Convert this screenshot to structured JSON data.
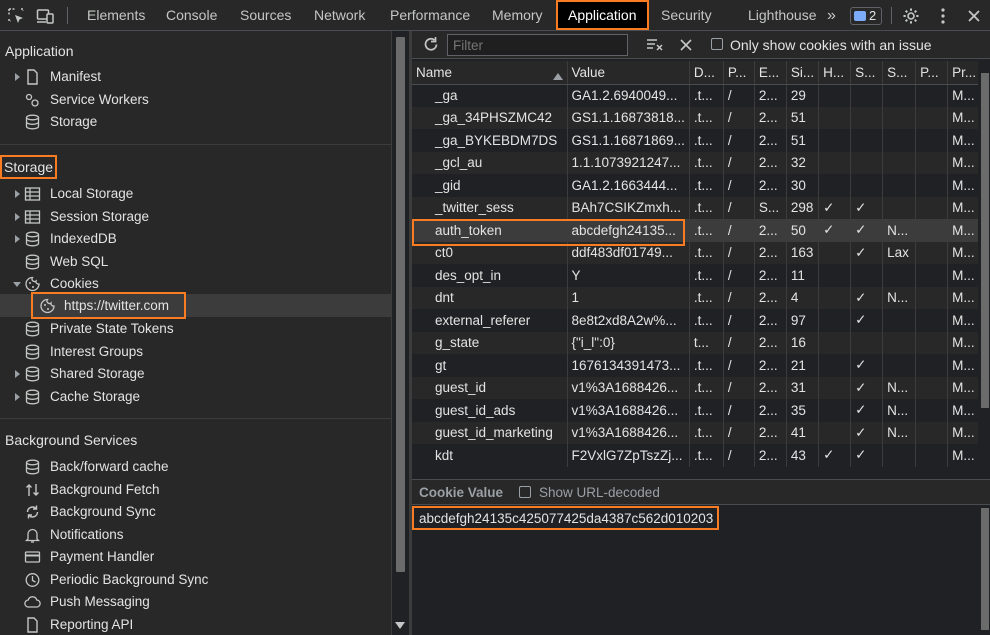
{
  "tabs": {
    "elements": "Elements",
    "console": "Console",
    "sources": "Sources",
    "network": "Network",
    "performance": "Performance",
    "memory": "Memory",
    "application": "Application",
    "security": "Security",
    "lighthouse": "Lighthouse",
    "more": "»",
    "issues_count": "2"
  },
  "sidebar": {
    "application_title": "Application",
    "application_items": {
      "manifest": "Manifest",
      "service_workers": "Service Workers",
      "storage": "Storage"
    },
    "storage_title": "Storage",
    "storage_items": {
      "local_storage": "Local Storage",
      "session_storage": "Session Storage",
      "indexeddb": "IndexedDB",
      "web_sql": "Web SQL",
      "cookies": "Cookies",
      "twitter": "https://twitter.com",
      "private_state_tokens": "Private State Tokens",
      "interest_groups": "Interest Groups",
      "shared_storage": "Shared Storage",
      "cache_storage": "Cache Storage"
    },
    "background_title": "Background Services",
    "background_items": {
      "bfcache": "Back/forward cache",
      "bg_fetch": "Background Fetch",
      "bg_sync": "Background Sync",
      "notifications": "Notifications",
      "payment_handler": "Payment Handler",
      "periodic_sync": "Periodic Background Sync",
      "push_messaging": "Push Messaging",
      "reporting_api": "Reporting API"
    }
  },
  "toolbar": {
    "filter_placeholder": "Filter",
    "only_issue_label": "Only show cookies with an issue"
  },
  "table": {
    "headers": [
      "Name",
      "Value",
      "D...",
      "P...",
      "E...",
      "Si...",
      "H...",
      "S...",
      "S...",
      "P...",
      "Pr..."
    ],
    "rows": [
      [
        "_ga",
        "GA1.2.6940049...",
        ".t...",
        "/",
        "2...",
        "29",
        "",
        "",
        "",
        "",
        "M..."
      ],
      [
        "_ga_34PHSZMC42",
        "GS1.1.16873818...",
        ".t...",
        "/",
        "2...",
        "51",
        "",
        "",
        "",
        "",
        "M..."
      ],
      [
        "_ga_BYKEBDM7DS",
        "GS1.1.16871869...",
        ".t...",
        "/",
        "2...",
        "51",
        "",
        "",
        "",
        "",
        "M..."
      ],
      [
        "_gcl_au",
        "1.1.1073921247...",
        ".t...",
        "/",
        "2...",
        "32",
        "",
        "",
        "",
        "",
        "M..."
      ],
      [
        "_gid",
        "GA1.2.1663444...",
        ".t...",
        "/",
        "2...",
        "30",
        "",
        "",
        "",
        "",
        "M..."
      ],
      [
        "_twitter_sess",
        "BAh7CSIKZmxh...",
        ".t...",
        "/",
        "S...",
        "298",
        "✓",
        "✓",
        "",
        "",
        "M..."
      ],
      [
        "auth_token",
        "abcdefgh24135...",
        ".t...",
        "/",
        "2...",
        "50",
        "✓",
        "✓",
        "N...",
        "",
        "M..."
      ],
      [
        "ct0",
        "ddf483df01749...",
        ".t...",
        "/",
        "2...",
        "163",
        "",
        "✓",
        "Lax",
        "",
        "M..."
      ],
      [
        "des_opt_in",
        "Y",
        ".t...",
        "/",
        "2...",
        "11",
        "",
        "",
        "",
        "",
        "M..."
      ],
      [
        "dnt",
        "1",
        ".t...",
        "/",
        "2...",
        "4",
        "",
        "✓",
        "N...",
        "",
        "M..."
      ],
      [
        "external_referer",
        "8e8t2xd8A2w%...",
        ".t...",
        "/",
        "2...",
        "97",
        "",
        "✓",
        "",
        "",
        "M..."
      ],
      [
        "g_state",
        "{\"i_l\":0}",
        "t...",
        "/",
        "2...",
        "16",
        "",
        "",
        "",
        "",
        "M..."
      ],
      [
        "gt",
        "1676134391473...",
        ".t...",
        "/",
        "2...",
        "21",
        "",
        "✓",
        "",
        "",
        "M..."
      ],
      [
        "guest_id",
        "v1%3A1688426...",
        ".t...",
        "/",
        "2...",
        "31",
        "",
        "✓",
        "N...",
        "",
        "M..."
      ],
      [
        "guest_id_ads",
        "v1%3A1688426...",
        ".t...",
        "/",
        "2...",
        "35",
        "",
        "✓",
        "N...",
        "",
        "M..."
      ],
      [
        "guest_id_marketing",
        "v1%3A1688426...",
        ".t...",
        "/",
        "2...",
        "41",
        "",
        "✓",
        "N...",
        "",
        "M..."
      ],
      [
        "kdt",
        "F2VxlG7ZpTszZj...",
        ".t...",
        "/",
        "2...",
        "43",
        "✓",
        "✓",
        "",
        "",
        "M..."
      ]
    ]
  },
  "cookie_value": {
    "title": "Cookie Value",
    "decode_label": "Show URL-decoded",
    "value": "abcdefgh24135c425077425da4387c562d010203"
  }
}
